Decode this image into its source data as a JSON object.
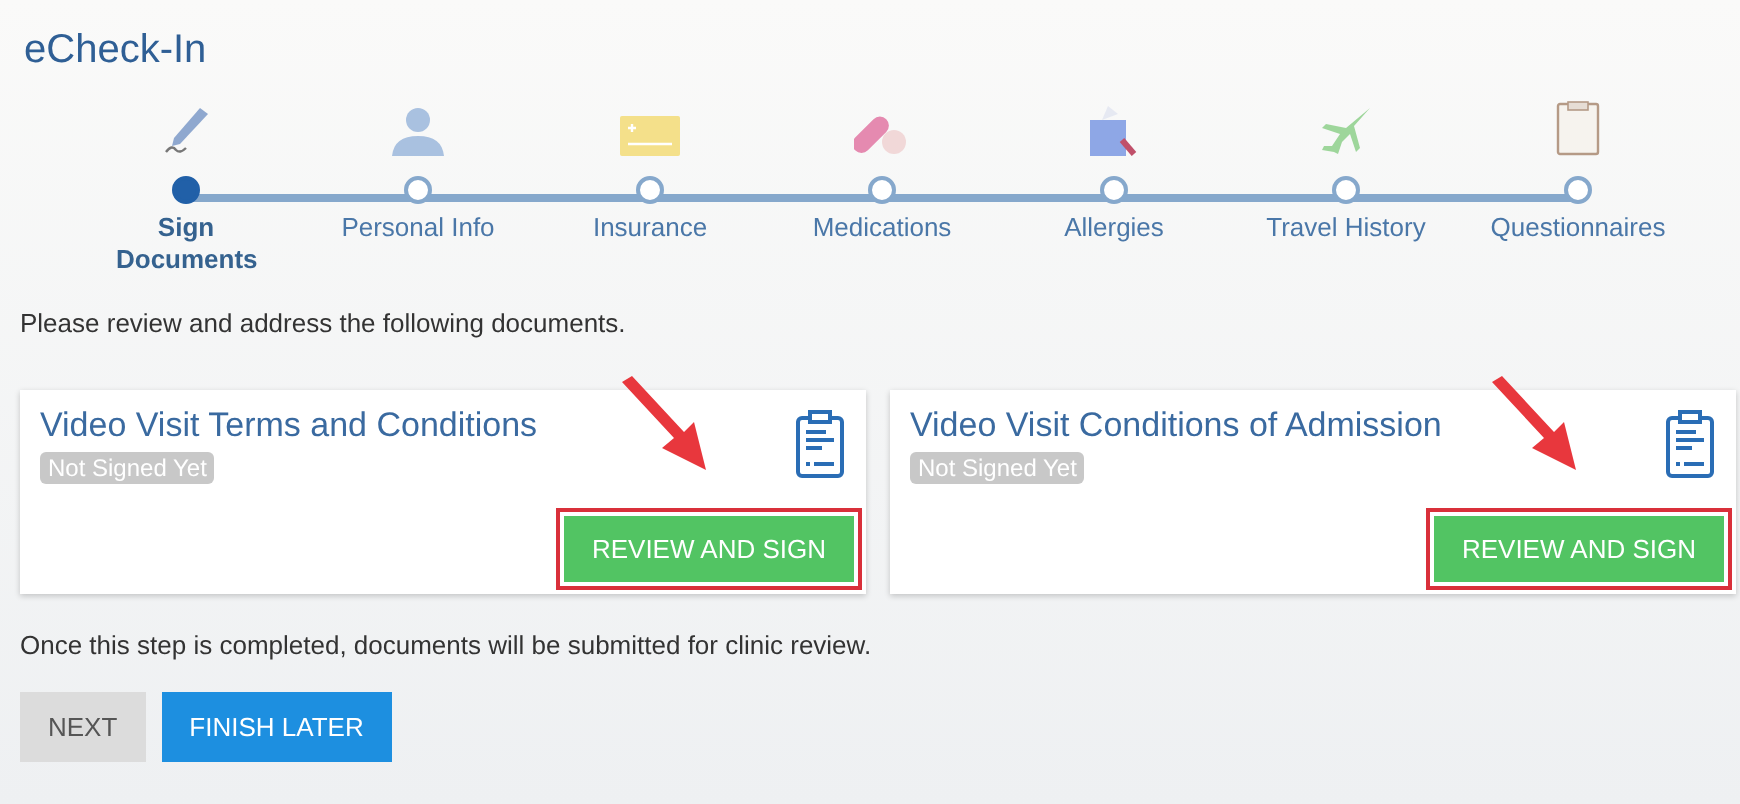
{
  "title": "eCheck-In",
  "steps": [
    {
      "label": "Sign Documents",
      "selected": true
    },
    {
      "label": "Personal Info",
      "selected": false
    },
    {
      "label": "Insurance",
      "selected": false
    },
    {
      "label": "Medications",
      "selected": false
    },
    {
      "label": "Allergies",
      "selected": false
    },
    {
      "label": "Travel History",
      "selected": false
    },
    {
      "label": "Questionnaires",
      "selected": false
    }
  ],
  "instructions": "Please review and address the following documents.",
  "documents": [
    {
      "title": "Video Visit Terms and Conditions",
      "status": "Not Signed Yet",
      "button": "REVIEW AND SIGN",
      "highlighted": true
    },
    {
      "title": "Video Visit Conditions of Admission",
      "status": "Not Signed Yet",
      "button": "REVIEW AND SIGN",
      "highlighted": true
    }
  ],
  "note": "Once this step is completed, documents will be submitted for clinic review.",
  "buttons": [
    {
      "label": "NEXT",
      "kind": "secondary"
    },
    {
      "label": "FINISH LATER",
      "kind": "primary"
    }
  ]
}
